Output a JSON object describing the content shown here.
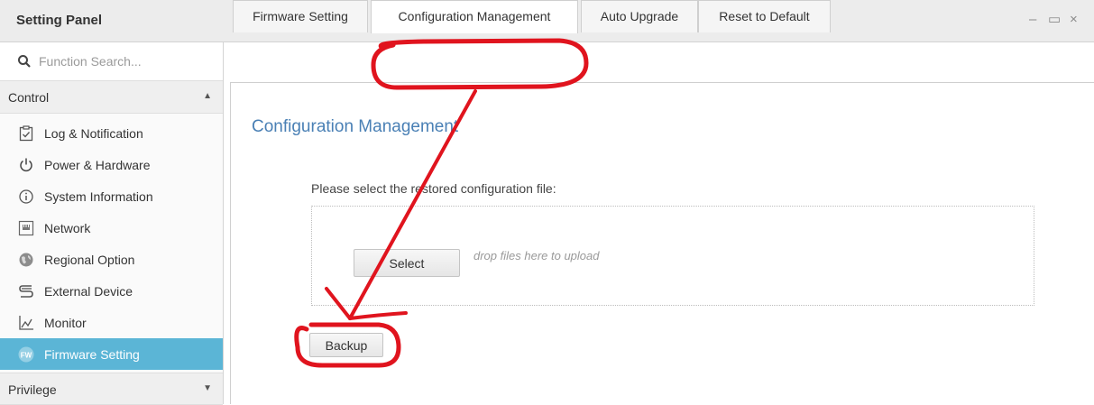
{
  "window": {
    "title": "Setting Panel",
    "controls": [
      "–",
      "▭",
      "×"
    ]
  },
  "sidebar": {
    "search_placeholder": "Function Search...",
    "groups": [
      {
        "label": "Control",
        "arrow": "▲"
      },
      {
        "label": "Privilege",
        "arrow": "▼"
      }
    ],
    "items": [
      {
        "label": "Log & Notification",
        "icon": "clipboard-check-icon"
      },
      {
        "label": "Power & Hardware",
        "icon": "power-icon"
      },
      {
        "label": "System Information",
        "icon": "info-icon"
      },
      {
        "label": "Network",
        "icon": "network-icon"
      },
      {
        "label": "Regional Option",
        "icon": "globe-icon"
      },
      {
        "label": "External Device",
        "icon": "external-device-icon"
      },
      {
        "label": "Monitor",
        "icon": "monitor-chart-icon"
      },
      {
        "label": "Firmware Setting",
        "icon": "firmware-icon",
        "active": true
      }
    ],
    "active_color": "#5bb5d6"
  },
  "tabs": [
    {
      "label": "Firmware Setting"
    },
    {
      "label": "Configuration Management",
      "active": true
    },
    {
      "label": "Auto Upgrade"
    },
    {
      "label": "Reset to Default"
    }
  ],
  "main": {
    "section_title": "Configuration Management",
    "prompt": "Please select the restored configuration file:",
    "select_button": "Select",
    "drop_hint": "drop files here to upload",
    "backup_button": "Backup"
  },
  "colors": {
    "title_blue": "#4a80b5",
    "annotation_red": "#e0141e"
  }
}
